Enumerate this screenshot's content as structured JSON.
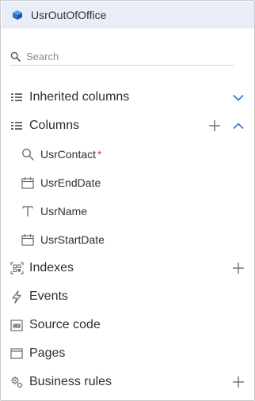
{
  "header": {
    "title": "UsrOutOfOffice",
    "icon": "cube-icon"
  },
  "search": {
    "placeholder": "Search"
  },
  "sections": {
    "inherited_columns": "Inherited columns",
    "columns": "Columns",
    "indexes": "Indexes",
    "events": "Events",
    "source_code": "Source code",
    "pages": "Pages",
    "business_rules": "Business rules"
  },
  "columns": [
    {
      "label": "UsrContact",
      "icon": "lookup-icon",
      "required": true
    },
    {
      "label": "UsrEndDate",
      "icon": "calendar-icon",
      "required": false
    },
    {
      "label": "UsrName",
      "icon": "text-icon",
      "required": false
    },
    {
      "label": "UsrStartDate",
      "icon": "calendar-icon",
      "required": false
    }
  ],
  "required_mark": "*",
  "colors": {
    "accent": "#2f7bd6",
    "header_bg": "#e8edf8",
    "required": "#d63a3a"
  }
}
